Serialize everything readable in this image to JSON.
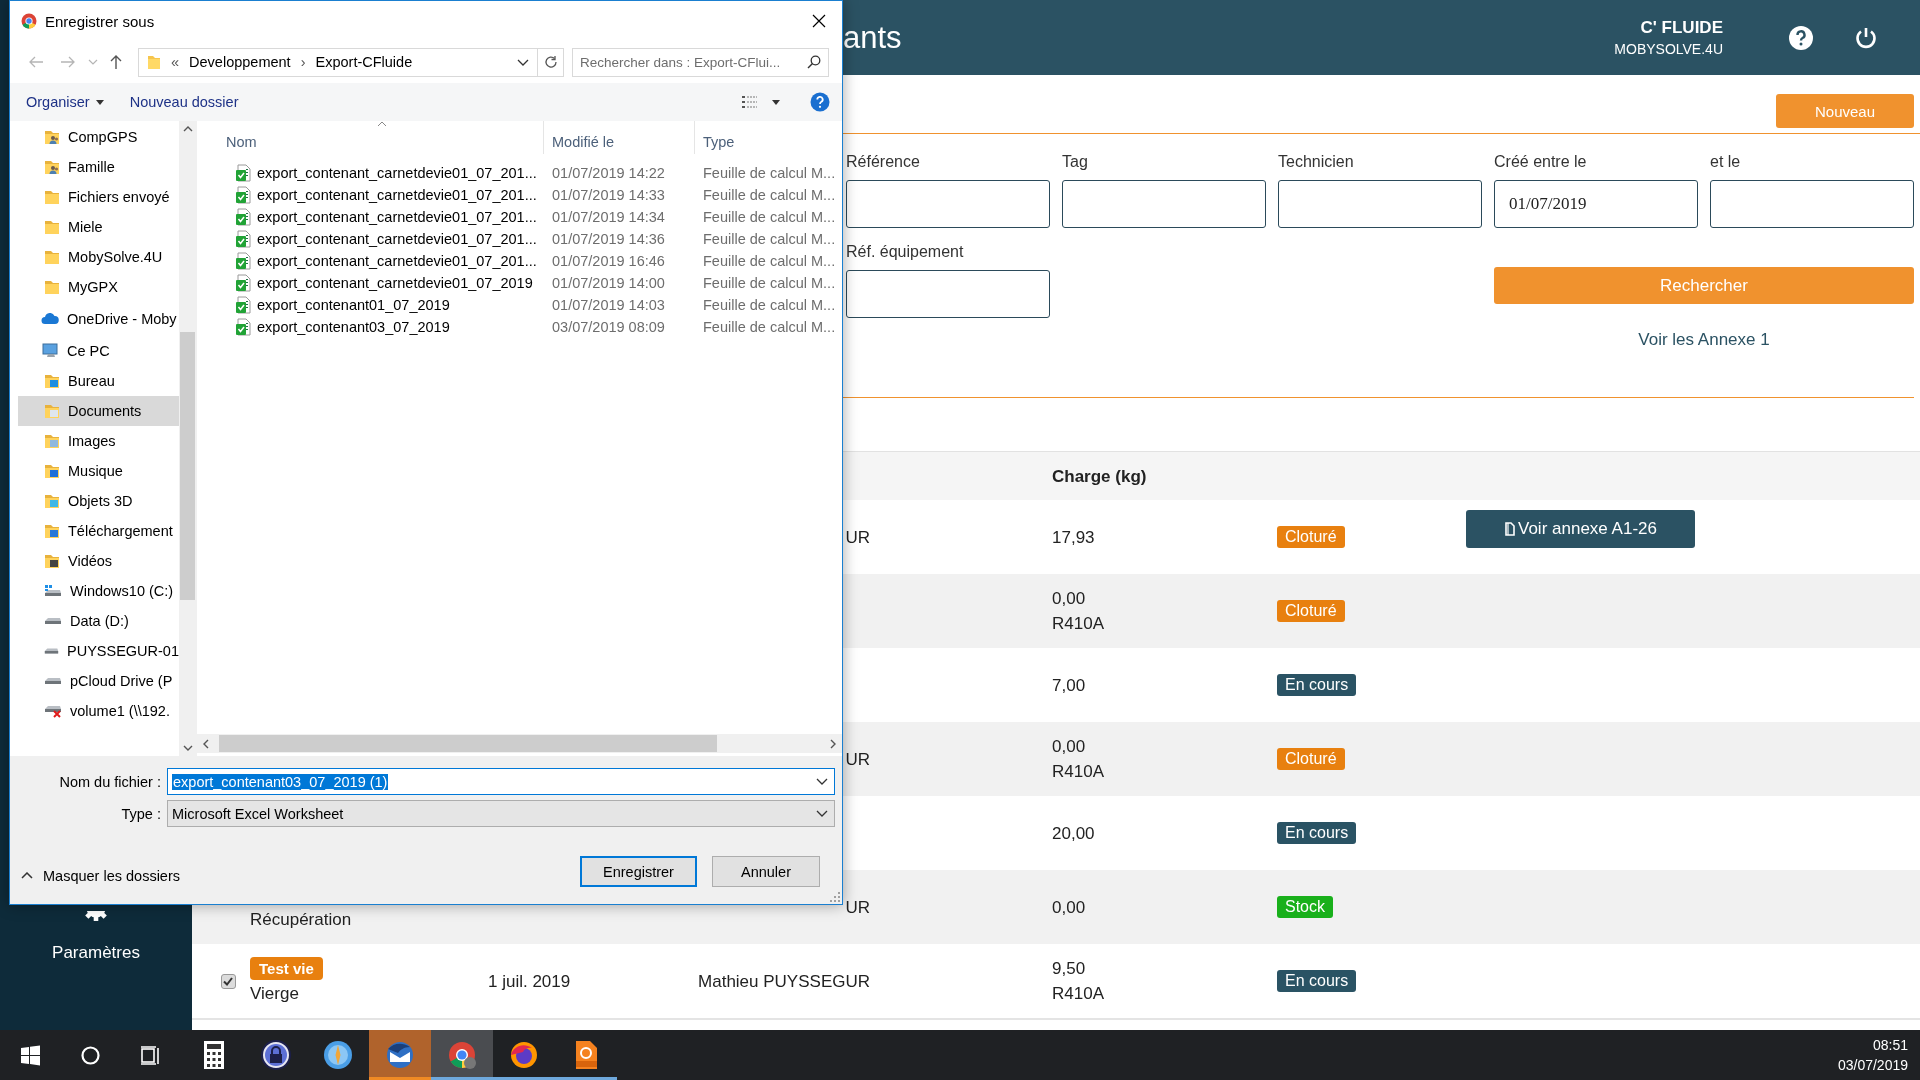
{
  "app": {
    "page_title": "ants",
    "brand": "C' FLUIDE",
    "brand_sub": "MOBYSOLVE.4U",
    "new_button": "Nouveau",
    "filters": [
      {
        "label": "Référence"
      },
      {
        "label": "Tag"
      },
      {
        "label": "Technicien"
      },
      {
        "label": "Créé entre le",
        "value": "01/07/2019"
      },
      {
        "label": "et le"
      },
      {
        "label": "Réf. équipement"
      }
    ],
    "search_button": "Rechercher",
    "annex_link": "Voir les Annexe 1",
    "sidebar": {
      "items": [
        {
          "label": "Paramètres"
        }
      ]
    },
    "table": {
      "charge_heading": "Charge (kg)",
      "rows": [
        {
          "technician": "UR",
          "charge": "17,93",
          "status": "Cloturé",
          "color": "#e8800f",
          "action": "Voir annexe A1-26"
        },
        {
          "charge": "0,00",
          "fluid": "R410A",
          "status": "Cloturé",
          "color": "#e8800f"
        },
        {
          "charge": "7,00",
          "status": "En cours",
          "color": "#2a5364"
        },
        {
          "technician": "UR",
          "charge": "0,00",
          "fluid": "R410A",
          "status": "Cloturé",
          "color": "#e8800f"
        },
        {
          "charge": "20,00",
          "status": "En cours",
          "color": "#2a5364"
        },
        {
          "type": "Récupération",
          "technician": "UR",
          "charge": "0,00",
          "status": "Stock",
          "color": "#19b01b"
        },
        {
          "checked": true,
          "tag": "Test vie",
          "type": "Vierge",
          "date": "1 juil. 2019",
          "technician": "Mathieu PUYSSEGUR",
          "charge": "9,50",
          "fluid": "R410A",
          "status": "En cours",
          "color": "#2a5364"
        }
      ]
    }
  },
  "dialog": {
    "title": "Enregistrer sous",
    "path": [
      "Developpement",
      "Export-CFluide"
    ],
    "path_prefix": "«",
    "path_separator": "›",
    "search": {
      "placeholder": "Rechercher dans : Export-CFlui..."
    },
    "toolbar": {
      "organize": "Organiser",
      "new_folder": "Nouveau dossier"
    },
    "nav": [
      {
        "kind": "scrolled-parent",
        "children": [
          {
            "label": "CompGPS",
            "kind": "folder-people",
            "selected": false
          },
          {
            "label": "Famille",
            "kind": "folder-people",
            "selected": false
          },
          {
            "label": "Fichiers envoyé",
            "kind": "folder",
            "selected": false
          },
          {
            "label": "Miele",
            "kind": "folder",
            "selected": false
          },
          {
            "label": "MobySolve.4U",
            "kind": "folder",
            "selected": false
          },
          {
            "label": "MyGPX",
            "kind": "folder",
            "selected": false
          }
        ]
      },
      {
        "label": "OneDrive - Moby",
        "kind": "cloud",
        "selected": false
      },
      {
        "label": "Ce PC",
        "kind": "computer",
        "selected": false,
        "children": [
          {
            "label": "Bureau",
            "kind": "folder-desktop",
            "selected": false
          },
          {
            "label": "Documents",
            "kind": "folder-documents",
            "selected": true
          },
          {
            "label": "Images",
            "kind": "folder-images",
            "selected": false
          },
          {
            "label": "Musique",
            "kind": "folder-music",
            "selected": false
          },
          {
            "label": "Objets 3D",
            "kind": "folder-3d",
            "selected": false
          },
          {
            "label": "Téléchargement",
            "kind": "folder-downloads",
            "selected": false
          },
          {
            "label": "Vidéos",
            "kind": "folder-videos",
            "selected": false
          },
          {
            "label": "Windows10 (C:)",
            "kind": "system-drive",
            "selected": false
          },
          {
            "label": "Data (D:)",
            "kind": "drive",
            "selected": false
          },
          {
            "label": "PUYSSEGUR-01",
            "kind": "drive",
            "selected": false
          },
          {
            "label": "pCloud Drive (P",
            "kind": "drive",
            "selected": false
          },
          {
            "label": "volume1 (\\\\192.",
            "kind": "drive-offline",
            "selected": false
          }
        ]
      }
    ],
    "columns": [
      "Nom",
      "Modifié le",
      "Type"
    ],
    "files": [
      {
        "name": "export_contenant_carnetdevie01_07_201...",
        "modified": "01/07/2019 14:22",
        "type": "Feuille de calcul M..."
      },
      {
        "name": "export_contenant_carnetdevie01_07_201...",
        "modified": "01/07/2019 14:33",
        "type": "Feuille de calcul M..."
      },
      {
        "name": "export_contenant_carnetdevie01_07_201...",
        "modified": "01/07/2019 14:34",
        "type": "Feuille de calcul M..."
      },
      {
        "name": "export_contenant_carnetdevie01_07_201...",
        "modified": "01/07/2019 14:36",
        "type": "Feuille de calcul M..."
      },
      {
        "name": "export_contenant_carnetdevie01_07_201...",
        "modified": "01/07/2019 16:46",
        "type": "Feuille de calcul M..."
      },
      {
        "name": "export_contenant_carnetdevie01_07_2019",
        "modified": "01/07/2019 14:00",
        "type": "Feuille de calcul M..."
      },
      {
        "name": "export_contenant01_07_2019",
        "modified": "01/07/2019 14:03",
        "type": "Feuille de calcul M..."
      },
      {
        "name": "export_contenant03_07_2019",
        "modified": "03/07/2019 08:09",
        "type": "Feuille de calcul M..."
      }
    ],
    "filename_label": "Nom du fichier :",
    "filename": "export_contenant03_07_2019 (1)",
    "type_label": "Type :",
    "type_value": "Microsoft Excel Worksheet",
    "hide_folders": "Masquer les dossiers",
    "save_button": "Enregistrer",
    "cancel_button": "Annuler"
  },
  "taskbar": {
    "buttons": [
      {
        "kind": "start"
      },
      {
        "kind": "search"
      },
      {
        "kind": "task-view"
      }
    ],
    "apps": [
      {
        "kind": "calculator",
        "running": false,
        "focused": false,
        "flashing": false
      },
      {
        "kind": "lock",
        "running": false,
        "focused": false,
        "flashing": false
      },
      {
        "kind": "compass",
        "running": false,
        "focused": false,
        "flashing": false
      },
      {
        "kind": "mail",
        "running": true,
        "focused": false,
        "flashing": true
      },
      {
        "kind": "browser",
        "running": true,
        "focused": true,
        "flashing": false
      },
      {
        "kind": "firefox",
        "running": true,
        "focused": false,
        "flashing": false
      },
      {
        "kind": "pdf",
        "running": true,
        "focused": false,
        "flashing": false
      }
    ],
    "time": "08:51",
    "date": "03/07/2019"
  }
}
